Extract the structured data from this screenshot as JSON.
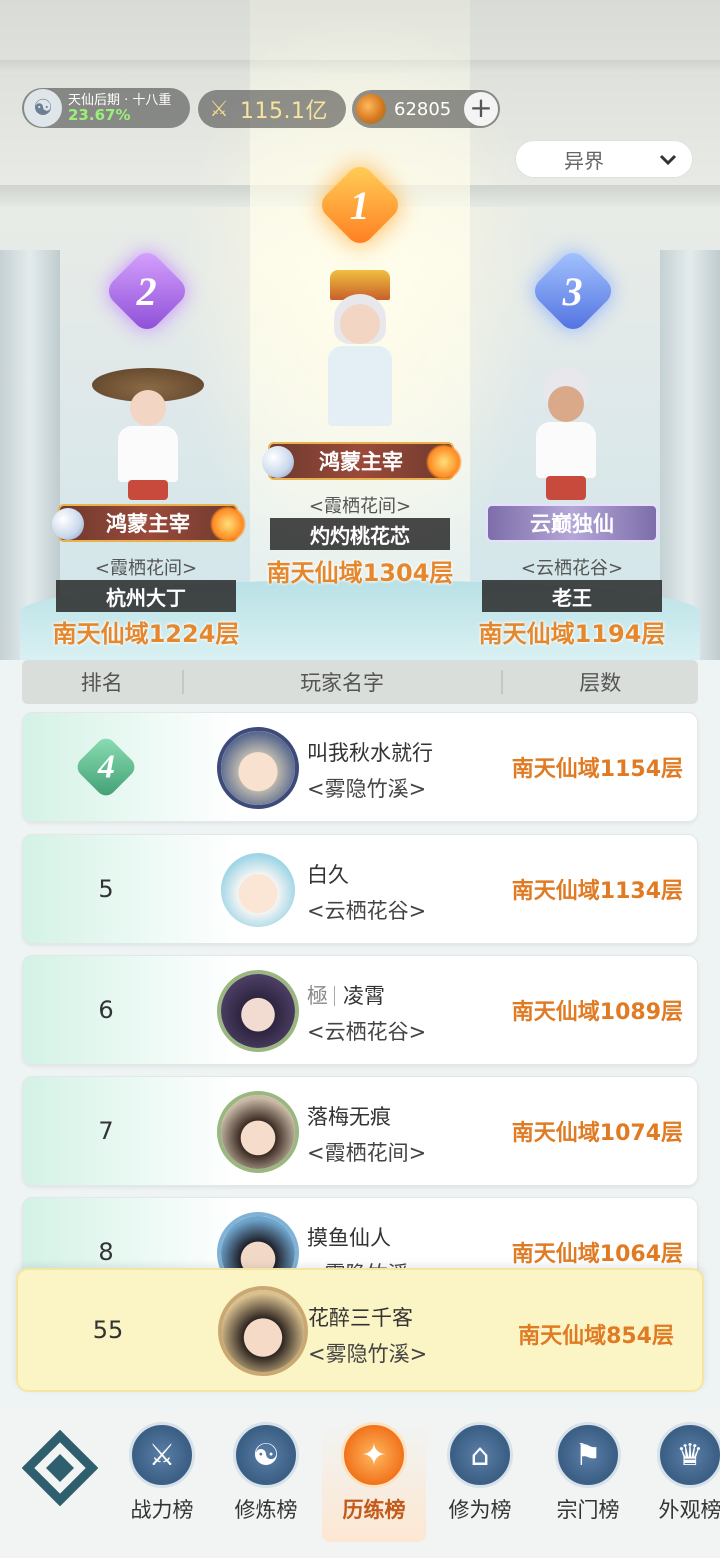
{
  "status": {
    "realm_title": "天仙后期 · 十八重",
    "realm_progress": "23.67%",
    "power": "115.1亿",
    "spirit_stones": "62805"
  },
  "realm_selector": {
    "label": "异界"
  },
  "podium": [
    {
      "rank": "1",
      "name": "鸿蒙主宰",
      "sect": "<霞栖花间>",
      "player": "灼灼桃花芯",
      "floor": "南天仙域1304层"
    },
    {
      "rank": "2",
      "name": "鸿蒙主宰",
      "sect": "<霞栖花间>",
      "player": "杭州大丁",
      "floor": "南天仙域1224层"
    },
    {
      "rank": "3",
      "name": "云巅独仙",
      "sect": "<云栖花谷>",
      "player": "老王",
      "floor": "南天仙域1194层"
    }
  ],
  "table": {
    "headers": {
      "rank": "排名",
      "name": "玩家名字",
      "floor": "层数"
    },
    "rows": [
      {
        "rank": "4",
        "prefix": "",
        "name": "叫我秋水就行",
        "sect": "<雾隐竹溪>",
        "floor": "南天仙域1154层"
      },
      {
        "rank": "5",
        "prefix": "",
        "name": "白久",
        "sect": "<云栖花谷>",
        "floor": "南天仙域1134层"
      },
      {
        "rank": "6",
        "prefix": "極",
        "name": "凌霄",
        "sect": "<云栖花谷>",
        "floor": "南天仙域1089层"
      },
      {
        "rank": "7",
        "prefix": "",
        "name": "落梅无痕",
        "sect": "<霞栖花间>",
        "floor": "南天仙域1074层"
      },
      {
        "rank": "8",
        "prefix": "",
        "name": "摸鱼仙人",
        "sect": "<雾隐竹溪>",
        "floor": "南天仙域1064层"
      }
    ]
  },
  "self": {
    "rank": "55",
    "name": "花醉三千客",
    "sect": "<雾隐竹溪>",
    "floor": "南天仙域854层"
  },
  "nav": [
    {
      "label": "战力榜",
      "icon": "crossed-swords-icon"
    },
    {
      "label": "修炼榜",
      "icon": "yin-yang-icon"
    },
    {
      "label": "历练榜",
      "icon": "star-burst-icon",
      "active": true
    },
    {
      "label": "修为榜",
      "icon": "hat-icon"
    },
    {
      "label": "宗门榜",
      "icon": "banner-icon"
    },
    {
      "label": "外观榜",
      "icon": "costume-icon"
    }
  ],
  "colors": {
    "accent_orange": "#e07b24",
    "self_row_bg": "#fbf4c4",
    "nav_blue": "#3c5f85"
  }
}
